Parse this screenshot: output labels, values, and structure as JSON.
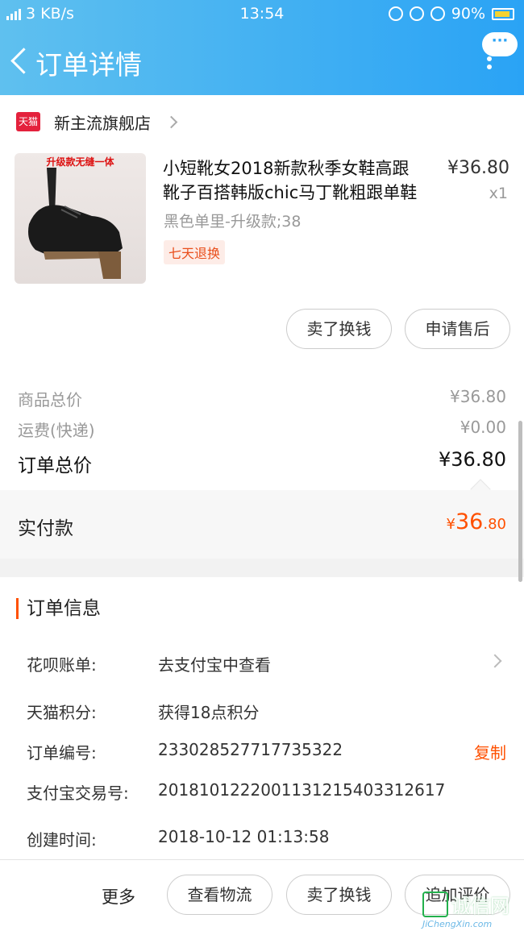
{
  "status_bar": {
    "speed": "3 KB/s",
    "time": "13:54",
    "battery": "90%",
    "network": "4G"
  },
  "nav": {
    "title": "订单详情",
    "more_label": "···"
  },
  "shop": {
    "logo_text": "天猫",
    "name": "新主流旗舰店"
  },
  "product": {
    "image_caption": "升级款无缝一体",
    "title": "小短靴女2018新款秋季女鞋高跟靴子百搭韩版chic马丁靴粗跟单鞋",
    "price": "¥36.80",
    "quantity": "x1",
    "sku": "黑色单里-升级款;38",
    "tag": "七天退换"
  },
  "item_actions": {
    "sell": "卖了换钱",
    "after_sale": "申请售后"
  },
  "summary": {
    "goods_label": "商品总价",
    "goods_value": "¥36.80",
    "shipping_label": "运费(快递)",
    "shipping_value": "¥0.00",
    "total_label": "订单总价",
    "total_value": "¥36.80"
  },
  "paid": {
    "label": "实付款",
    "currency": "¥",
    "integer": "36",
    "decimal": ".80"
  },
  "order_info": {
    "heading": "订单信息",
    "rows": [
      {
        "label": "花呗账单:",
        "value": "去支付宝中查看"
      },
      {
        "label": "天猫积分:",
        "value": "获得18点积分"
      },
      {
        "label": "订单编号:",
        "value": "233028527717735322",
        "action": "复制"
      },
      {
        "label": "支付宝交易号:",
        "value": "2018101222001131215403312617"
      },
      {
        "label": "创建时间:",
        "value": "2018-10-12 01:13:58"
      }
    ]
  },
  "bottom_bar": {
    "more": "更多",
    "logistics": "查看物流",
    "sell": "卖了换钱",
    "review": "追加评价"
  },
  "watermark": {
    "cn": "诚信网",
    "en": "JiChengXin.com"
  },
  "colors": {
    "accent": "#ff5000",
    "header": "#2aa3f5",
    "tmall": "#e4213c"
  }
}
